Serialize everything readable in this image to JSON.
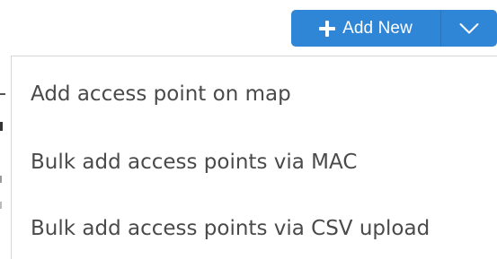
{
  "toolbar": {
    "add_new_label": "Add New",
    "plus_icon": "plus-icon",
    "dropdown_icon": "chevron-down-icon",
    "accent_color": "#2f86d6"
  },
  "menu": {
    "items": [
      {
        "label": "Add access point on map"
      },
      {
        "label": "Bulk add access points via MAC"
      },
      {
        "label": "Bulk add access points via CSV upload"
      }
    ]
  }
}
